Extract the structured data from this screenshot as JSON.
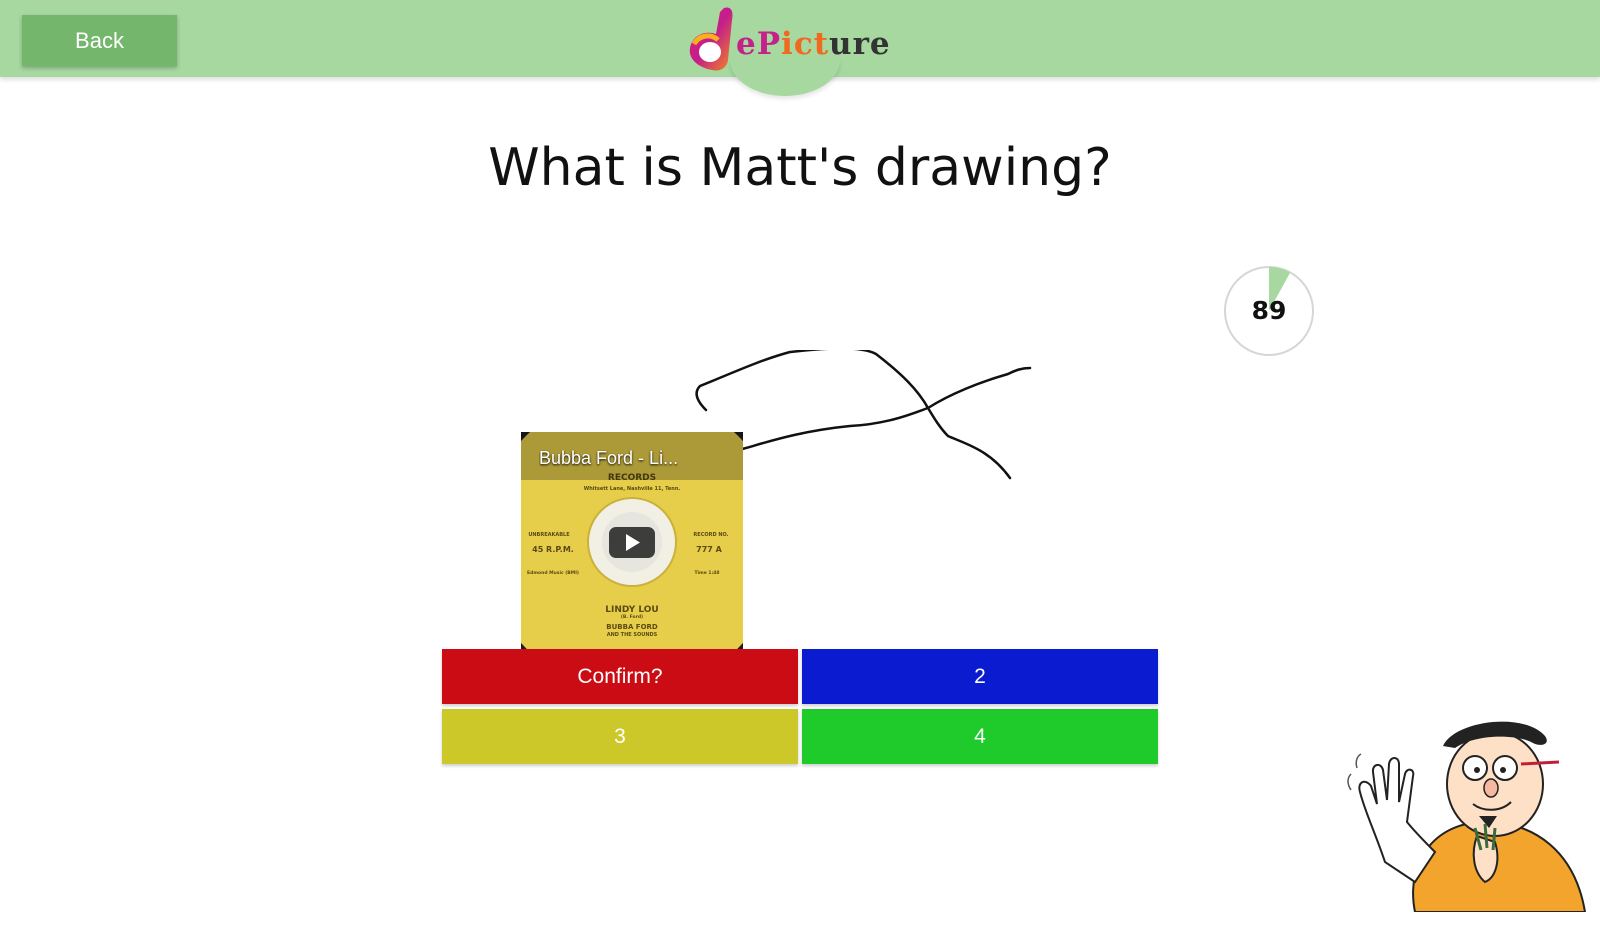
{
  "header": {
    "back_label": "Back",
    "logo_text_a": "eP",
    "logo_text_b": "ict",
    "logo_text_c": "ure",
    "background_color": "#a6d8a0"
  },
  "question": "What is Matt's drawing?",
  "timer": {
    "value": "89",
    "remaining_fraction": 0.92,
    "fill_color": "#a6d8a0"
  },
  "video": {
    "title": "Bubba Ford - Li...",
    "record": {
      "records_text": "RECORDS",
      "address_text": "Whitsett Lane, Nashville 11, Tenn.",
      "left_top": "UNBREAKABLE",
      "left_main": "45 R.P.M.",
      "right_top": "RECORD NO.",
      "right_main": "777 A",
      "left_bottom": "Edmond Music (BMI)",
      "right_bottom": "Time 1:48",
      "song": "LINDY LOU",
      "writer": "(B. Ford)",
      "artist": "BUBBA FORD",
      "band": "AND THE SOUNDS"
    }
  },
  "answers": [
    {
      "label": "Confirm?",
      "color": "#cc0c14"
    },
    {
      "label": "2",
      "color": "#0a1bd0"
    },
    {
      "label": "3",
      "color": "#cdc82a"
    },
    {
      "label": "4",
      "color": "#1ecb2a"
    }
  ]
}
